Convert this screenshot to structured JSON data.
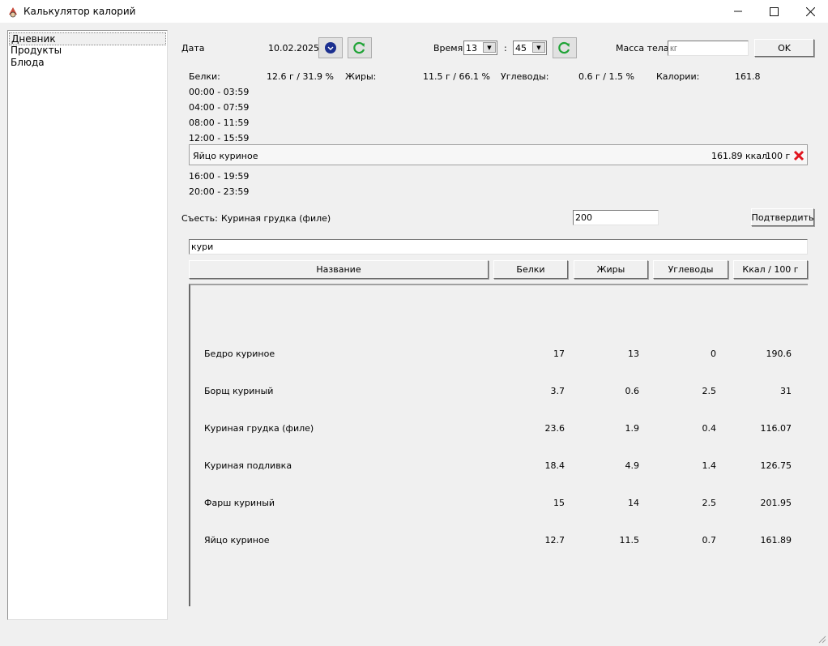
{
  "window": {
    "title": "Калькулятор калорий",
    "controls": {
      "minimize": "—",
      "maximize": "☐",
      "close": "✕"
    }
  },
  "sidebar": {
    "items": [
      {
        "label": "Дневник",
        "selected": true
      },
      {
        "label": "Продукты",
        "selected": false
      },
      {
        "label": "Блюда",
        "selected": false
      }
    ]
  },
  "header": {
    "date_label": "Дата",
    "date_value": "10.02.2025",
    "time_label": "Время",
    "hour_value": "13",
    "time_sep": ":",
    "minute_value": "45",
    "weight_label": "Масса тела",
    "weight_placeholder": "кг",
    "ok_label": "OK"
  },
  "summary": {
    "proteins_label": "Белки:",
    "proteins_value": "12.6 г / 31.9 %",
    "fats_label": "Жиры:",
    "fats_value": "11.5 г / 66.1 %",
    "carbs_label": "Углеводы:",
    "carbs_value": "0.6 г / 1.5 %",
    "calories_label": "Калории:",
    "calories_value": "161.8"
  },
  "time_slots": [
    "00:00 - 03:59",
    "04:00 - 07:59",
    "08:00 - 11:59",
    "12:00 - 15:59",
    "16:00 - 19:59",
    "20:00 - 23:59"
  ],
  "meal_entry": {
    "name": "Яйцо куриное",
    "kcal": "161.89 ккал",
    "weight": "100 г",
    "delete_icon": "red-x-icon"
  },
  "eat": {
    "label": "Съесть:",
    "product": "Куриная грудка (филе)",
    "amount_value": "200",
    "confirm_label": "Подтвердить"
  },
  "search": {
    "value": "кури"
  },
  "table": {
    "headers": [
      "Название",
      "Белки",
      "Жиры",
      "Углеводы",
      "Ккал / 100 г"
    ],
    "rows": [
      [
        "Бедро куриное",
        "17",
        "13",
        "0",
        "190.6"
      ],
      [
        "Борщ куриный",
        "3.7",
        "0.6",
        "2.5",
        "31"
      ],
      [
        "Куриная грудка (филе)",
        "23.6",
        "1.9",
        "0.4",
        "116.07"
      ],
      [
        "Куриная подливка",
        "18.4",
        "4.9",
        "1.4",
        "126.75"
      ],
      [
        "Фарш куриный",
        "15",
        "14",
        "2.5",
        "201.95"
      ],
      [
        "Яйцо куриное",
        "12.7",
        "11.5",
        "0.7",
        "161.89"
      ]
    ]
  },
  "colors": {
    "refresh_green": "#1fa336",
    "delete_red": "#e0141e",
    "calendar_blue": "#1b2f8f"
  }
}
